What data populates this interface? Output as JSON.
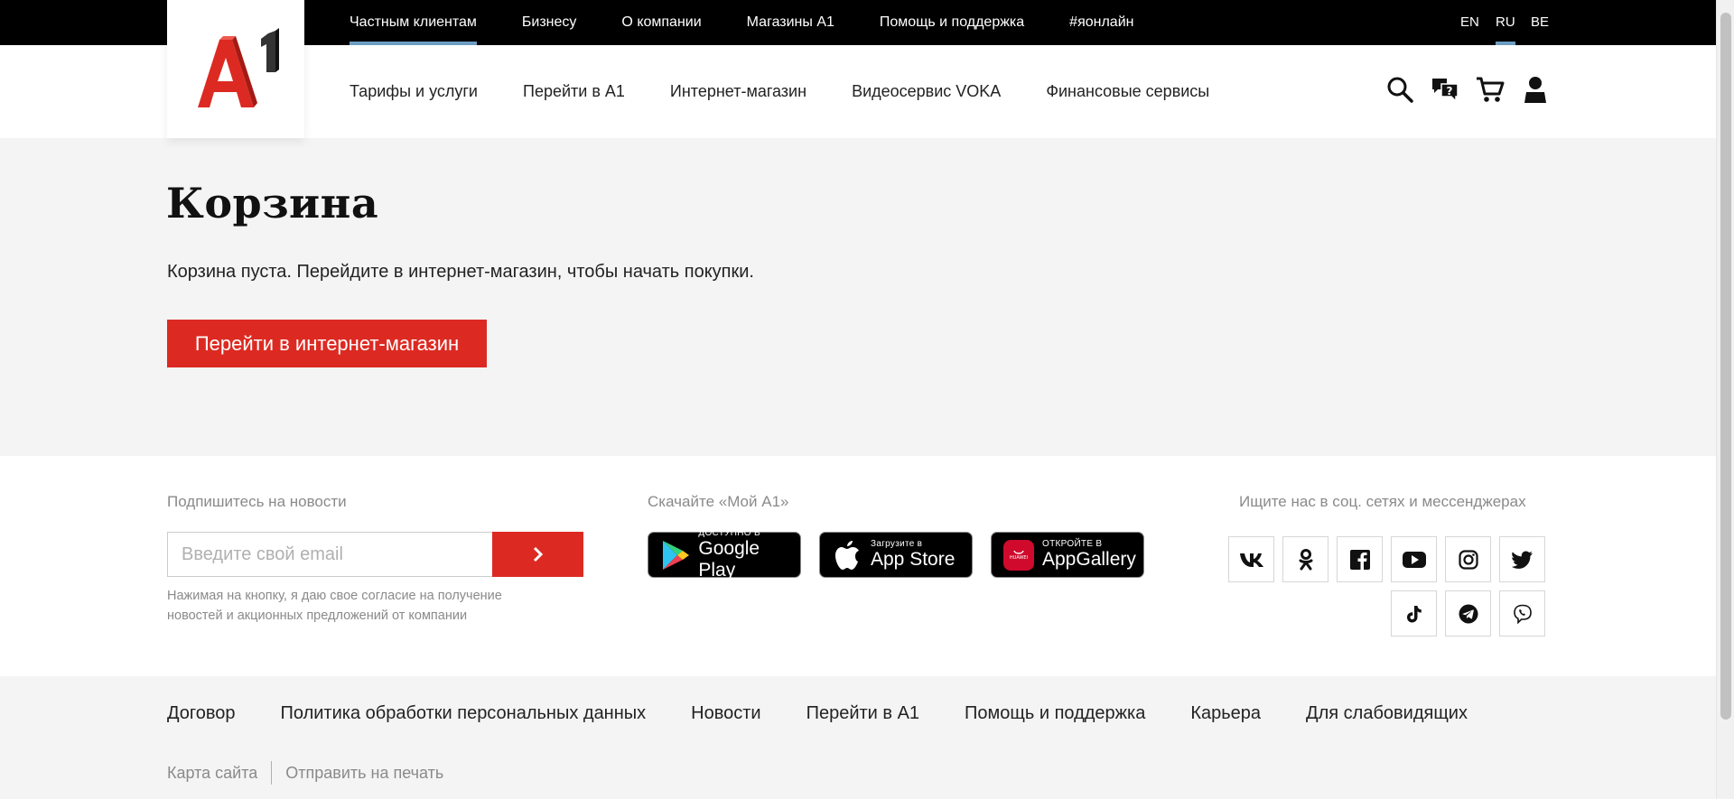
{
  "topbar": {
    "items": [
      {
        "label": "Частным клиентам",
        "active": true
      },
      {
        "label": "Бизнесу",
        "active": false
      },
      {
        "label": "О компании",
        "active": false
      },
      {
        "label": "Магазины А1",
        "active": false
      },
      {
        "label": "Помощь и поддержка",
        "active": false
      },
      {
        "label": "#яонлайн",
        "active": false
      }
    ],
    "languages": [
      {
        "label": "EN",
        "active": false
      },
      {
        "label": "RU",
        "active": true
      },
      {
        "label": "BE",
        "active": false
      }
    ]
  },
  "header": {
    "logo": {
      "name": "a1-logo",
      "text": "A1",
      "color": "#dc2a22"
    },
    "nav": [
      "Тарифы и услуги",
      "Перейти в А1",
      "Интернет-магазин",
      "Видеосервис VOKA",
      "Финансовые сервисы"
    ],
    "icons": [
      "search-icon",
      "support-chat-icon",
      "cart-icon",
      "user-icon"
    ]
  },
  "cart": {
    "title": "Корзина",
    "empty_message": "Корзина пуста. Перейдите в интернет-магазин, чтобы начать покупки.",
    "shop_button": "Перейти в интернет-магазин"
  },
  "footer": {
    "newsletter": {
      "label": "Подпишитесь на новости",
      "placeholder": "Введите свой email",
      "value": "",
      "consent": "Нажимая на кнопку, я даю свое согласие на получение новостей и акционных предложений от компании"
    },
    "apps": {
      "label": "Скачайте «Мой А1»",
      "stores": [
        {
          "name": "google-play",
          "small": "ДОСТУПНО В",
          "big": "Google Play"
        },
        {
          "name": "app-store",
          "small": "Загрузите в",
          "big": "App Store"
        },
        {
          "name": "app-gallery",
          "small": "ОТКРОЙТЕ В",
          "big": "AppGallery",
          "badge": "HUAWEI"
        }
      ]
    },
    "social": {
      "label": "Ищите нас в соц. сетях и мессенджерах",
      "networks": [
        "vk-icon",
        "odnoklassniki-icon",
        "facebook-icon",
        "youtube-icon",
        "instagram-icon",
        "twitter-icon",
        "tiktok-icon",
        "telegram-icon",
        "viber-icon"
      ]
    },
    "links": [
      "Договор",
      "Политика обработки персональных данных",
      "Новости",
      "Перейти в А1",
      "Помощь и поддержка",
      "Карьера",
      "Для слабовидящих"
    ],
    "sublinks": [
      "Карта сайта",
      "Отправить на печать"
    ]
  },
  "colors": {
    "brand_red": "#dc2a22",
    "active_underline": "#6e9fc4",
    "top_bar": "#000000",
    "page_bg": "#f4f4f4"
  }
}
